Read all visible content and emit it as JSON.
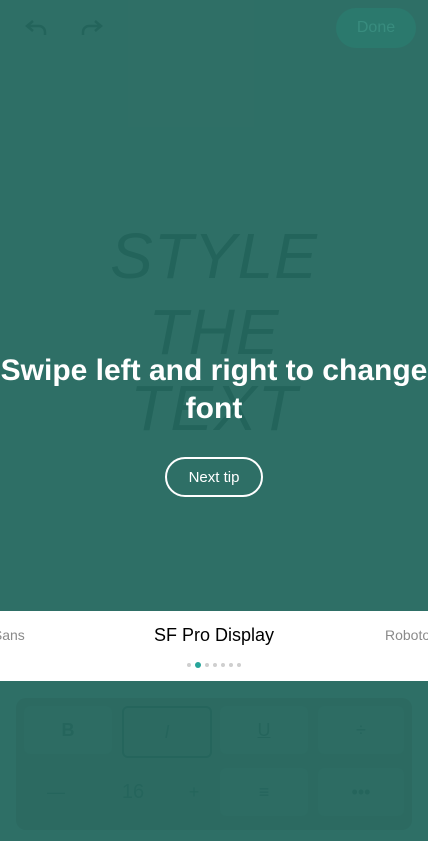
{
  "header": {
    "undo_icon": "undo-icon",
    "redo_icon": "redo-icon",
    "done_label": "Done"
  },
  "preview": {
    "lines": [
      "STYLE",
      "THE",
      "TEXT"
    ]
  },
  "onboarding": {
    "tip_text": "Swipe left and right to change font",
    "next_tip_label": "Next tip"
  },
  "font_carousel": {
    "left_font": "c Sans",
    "selected_font": "SF Pro Display",
    "right_font": "Roboto",
    "dots_count": 7,
    "active_index": 1,
    "active_color": "#27A59A"
  },
  "toolbar": {
    "bold_label": "B",
    "italic_label": "I",
    "underline_label": "U",
    "strike_label": "÷",
    "minus_label": "—",
    "size_value": "16",
    "plus_label": "+",
    "align_label": "≡",
    "more_label": "•••"
  },
  "colors": {
    "background": "#2F6F66",
    "preview_text": "#1E5E55",
    "strip_bg": "#FFFFFF"
  }
}
